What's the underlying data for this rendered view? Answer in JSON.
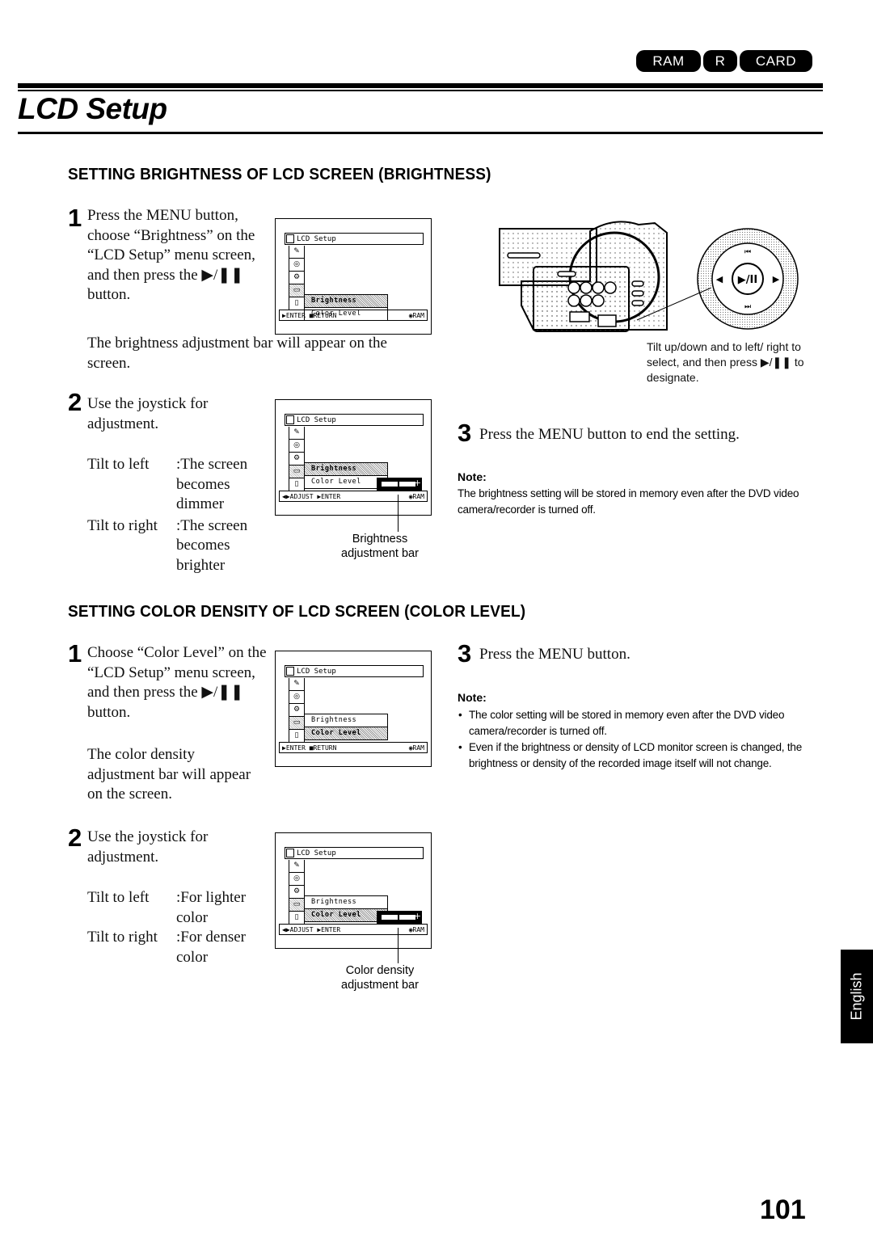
{
  "media_badges": [
    "RAM",
    "R",
    "CARD"
  ],
  "page_title": "LCD Setup",
  "section1": {
    "heading": "SETTING BRIGHTNESS OF LCD SCREEN (BRIGHTNESS)",
    "step1": {
      "num": "1",
      "text": "Press the MENU button, choose “Brightness” on the “LCD Setup” menu screen, and then press the ▶/❚❚ button.",
      "after": "The brightness adjustment bar will appear on the screen."
    },
    "step2": {
      "num": "2",
      "text": "Use the joystick for adjustment.",
      "tilt_left_key": "Tilt to left",
      "tilt_left_val": ":The screen becomes dimmer",
      "tilt_right_key": "Tilt to right",
      "tilt_right_val": ":The screen becomes brighter",
      "callout": "Brightness adjustment bar"
    },
    "step3": {
      "num": "3",
      "text": "Press the MENU button to end the setting."
    },
    "camera_caption": "Tilt up/down and to left/ right to select, and then press ▶/❚❚ to designate.",
    "note_title": "Note:",
    "note": "The brightness setting will be stored in memory even after the DVD video camera/recorder is turned off."
  },
  "section2": {
    "heading": "SETTING COLOR DENSITY OF LCD SCREEN (COLOR LEVEL)",
    "step1": {
      "num": "1",
      "text": "Choose “Color Level” on the “LCD Setup” menu screen, and then press the ▶/❚❚ button.",
      "after": "The color density adjustment bar will appear on the screen."
    },
    "step2": {
      "num": "2",
      "text": "Use the joystick for adjustment.",
      "tilt_left_key": "Tilt to left",
      "tilt_left_val": ":For lighter color",
      "tilt_right_key": "Tilt to right",
      "tilt_right_val": ":For denser color",
      "callout": "Color density adjustment bar"
    },
    "step3": {
      "num": "3",
      "text": "Press the MENU button."
    },
    "note_title": "Note:",
    "notes": [
      "The color setting will be stored in memory even after the DVD video camera/recorder is turned off.",
      "Even if the brightness or density of LCD monitor screen is changed, the brightness or density of the recorded image itself will not change."
    ]
  },
  "lcd": {
    "title": "LCD Setup",
    "items": [
      "Brightness",
      "Color Level"
    ],
    "footer_menu_left": "▶ENTER ■RETURN",
    "footer_adjust_left": "◀▶ADJUST ▶ENTER",
    "footer_right": "◉RAM",
    "icons": [
      "camera-icon",
      "disc-icon",
      "settings-icon",
      "lcd-icon",
      "card-icon"
    ],
    "bar_level": 0.5
  },
  "language_tab": "English",
  "page_number": "101"
}
